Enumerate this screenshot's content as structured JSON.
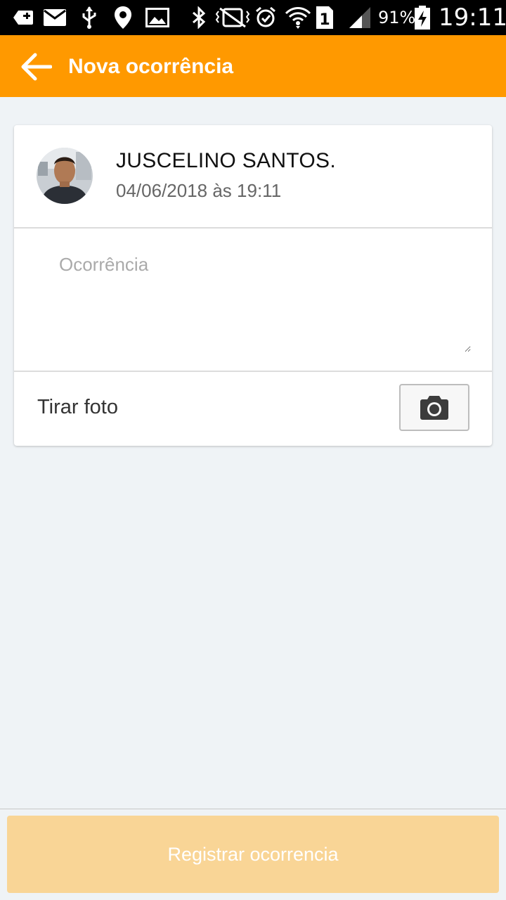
{
  "status_bar": {
    "icons": [
      "add-box-icon",
      "mail-icon",
      "usb-icon",
      "location-pin-icon",
      "image-icon",
      "bluetooth-icon",
      "vibrate-mute-icon",
      "alarm-icon",
      "wifi-icon",
      "sim-1-icon",
      "signal-icon",
      "battery-charging-icon"
    ],
    "battery": "91%",
    "time": "19:11"
  },
  "app_bar": {
    "title": "Nova ocorrência",
    "back_icon": "arrow-back-icon",
    "background_color": "#ff9900"
  },
  "card": {
    "author": {
      "name": "JUSCELINO SANTOS.",
      "date": "04/06/2018 às 19:11"
    },
    "occurrence": {
      "placeholder": "Ocorrência",
      "value": ""
    },
    "photo": {
      "label": "Tirar foto",
      "icon": "camera-icon"
    }
  },
  "submit": {
    "label": "Registrar ocorrencia",
    "background_color": "#f9d596"
  }
}
